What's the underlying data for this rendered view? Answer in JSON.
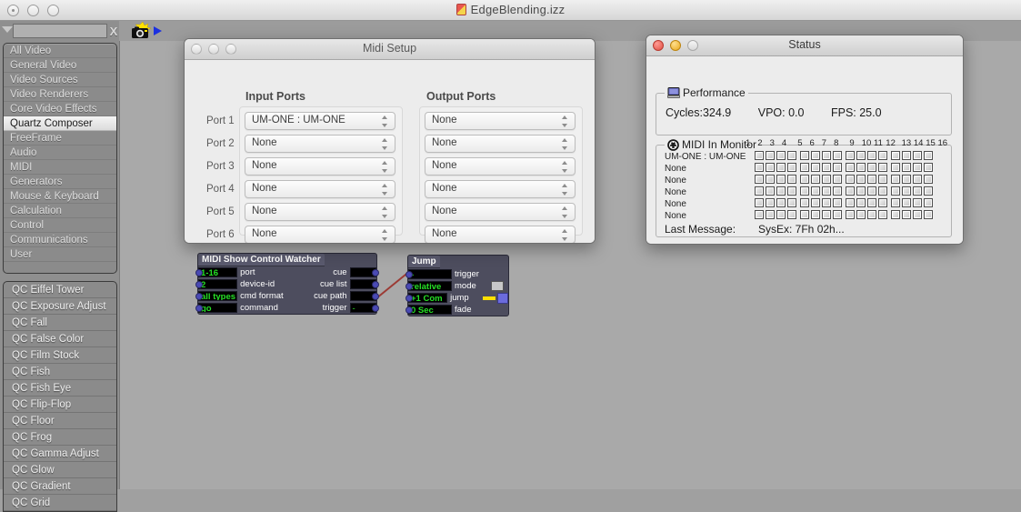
{
  "app": {
    "title": "EdgeBlending.izz",
    "doc_icon": "document-icon"
  },
  "search": {
    "value": "",
    "placeholder": "",
    "clear_label": "X",
    "disclosure_icon": "triangle-down-icon"
  },
  "toolbar": {
    "snapshot_icon": "camera-snapshot-icon",
    "play_icon": "play-triangle-icon"
  },
  "categories": {
    "selected": "Quartz Composer",
    "items": [
      "All Video",
      "General Video",
      "Video Sources",
      "Video Renderers",
      "Core Video Effects",
      "Quartz Composer",
      "FreeFrame",
      "Audio",
      "MIDI",
      "Generators",
      "Mouse & Keyboard",
      "Calculation",
      "Control",
      "Communications",
      "User"
    ]
  },
  "patches": {
    "items": [
      "QC Eiffel Tower",
      "QC Exposure Adjust",
      "QC Fall",
      "QC False Color",
      "QC Film Stock",
      "QC Fish",
      "QC Fish Eye",
      "QC Flip-Flop",
      "QC Floor",
      "QC Frog",
      "QC Gamma Adjust",
      "QC Glow",
      "QC Gradient",
      "QC Grid"
    ]
  },
  "midi_setup": {
    "title": "Midi Setup",
    "input_header": "Input Ports",
    "output_header": "Output Ports",
    "ports": [
      {
        "label": "Port 1",
        "input": "UM-ONE : UM-ONE",
        "output": "None"
      },
      {
        "label": "Port 2",
        "input": "None",
        "output": "None"
      },
      {
        "label": "Port 3",
        "input": "None",
        "output": "None"
      },
      {
        "label": "Port 4",
        "input": "None",
        "output": "None"
      },
      {
        "label": "Port 5",
        "input": "None",
        "output": "None"
      },
      {
        "label": "Port 6",
        "input": "None",
        "output": "None"
      }
    ]
  },
  "status": {
    "title": "Status",
    "performance": {
      "legend": "Performance",
      "icon": "monitor-icon",
      "cycles": "Cycles:324.9",
      "vpo": "VPO: 0.0",
      "fps": "FPS: 25.0"
    },
    "midi_in_monitor": {
      "legend": "MIDI In Monitor",
      "icon": "midi-din-icon",
      "channels": [
        "1",
        "2",
        "3",
        "4",
        "5",
        "6",
        "7",
        "8",
        "9",
        "10",
        "11",
        "12",
        "13",
        "14",
        "15",
        "16"
      ],
      "rows": [
        {
          "name": "UM-ONE : UM-ONE"
        },
        {
          "name": "None"
        },
        {
          "name": "None"
        },
        {
          "name": "None"
        },
        {
          "name": "None"
        },
        {
          "name": "None"
        }
      ],
      "last_message_label": "Last Message:",
      "last_message_value": "SysEx: 7Fh 02h..."
    }
  },
  "nodes": {
    "msc": {
      "title": "MIDI Show Control Watcher",
      "inputs": [
        {
          "value": "1-16",
          "label": "port"
        },
        {
          "value": "2",
          "label": "device-id"
        },
        {
          "value": "all types",
          "label": "cmd format"
        },
        {
          "value": "go",
          "label": "command"
        }
      ],
      "outputs": [
        {
          "label": "cue",
          "value": ""
        },
        {
          "label": "cue list",
          "value": ""
        },
        {
          "label": "cue path",
          "value": ""
        },
        {
          "label": "trigger",
          "value": "-"
        }
      ]
    },
    "jump": {
      "title": "Jump",
      "rows": [
        {
          "value": "-",
          "label": "trigger"
        },
        {
          "value": "relative",
          "label": "mode"
        },
        {
          "value": "+1 Com",
          "label": "jump"
        },
        {
          "value": "0 Sec",
          "label": "fade"
        }
      ]
    }
  },
  "colors": {
    "node_body": "#4d4d5e",
    "node_value_text": "#26e026",
    "wire": "#9c3b35",
    "accent_blue": "#1b30e0",
    "selection": "#f0f0f0"
  }
}
